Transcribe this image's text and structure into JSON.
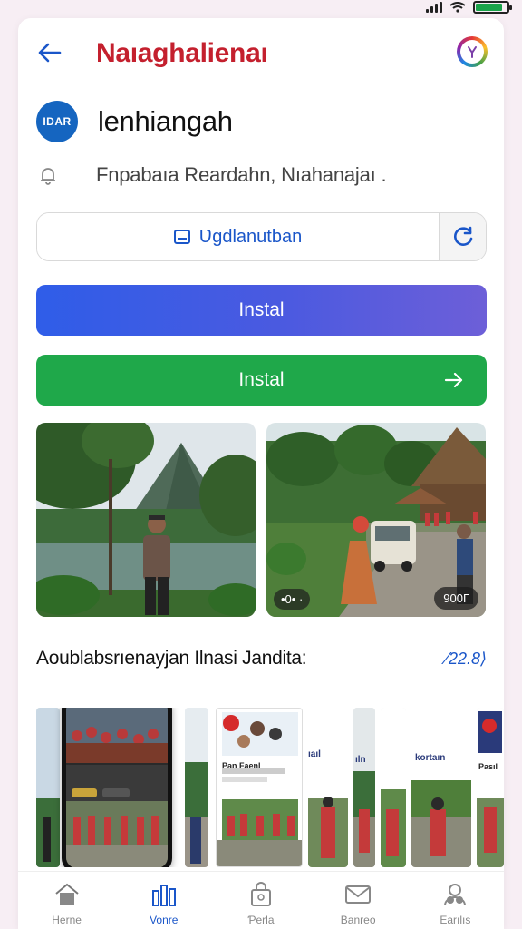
{
  "header": {
    "title": "Naıaghalienaı",
    "back_icon": "arrow-left-icon",
    "action_icon": "refresh-badge-icon"
  },
  "app": {
    "logo_text": "IDAR",
    "name": "Ɩenhiangah"
  },
  "info": {
    "icon": "bell-icon",
    "text": "Fnpabaıa Reardahn, Nıahanajaı ."
  },
  "field": {
    "label": "Ʋgdlanutban",
    "icon": "window-icon",
    "refresh_icon": "refresh-icon"
  },
  "buttons": {
    "primary_label": "Instal",
    "secondary_label": "Instal"
  },
  "photos": [
    {
      "caption": ""
    },
    {
      "badge_left": "•0• ·",
      "badge_right": "900Г"
    }
  ],
  "section": {
    "title": "Aoublabsrıenayjan Ilnasi Jandita:",
    "link": "⁄22.8⟩"
  },
  "gallery": {
    "labels": [
      "Pan Faenl",
      "ıaıl",
      "ıln",
      "kortaın",
      "Pasıl"
    ]
  },
  "tabs": [
    {
      "label": "Herne",
      "icon": "home-icon",
      "active": false
    },
    {
      "label": "Vonre",
      "icon": "bar-chart-icon",
      "active": true
    },
    {
      "label": "Ƥerla",
      "icon": "bag-icon",
      "active": false
    },
    {
      "label": "Banreo",
      "icon": "mail-icon",
      "active": false
    },
    {
      "label": "Earılıs",
      "icon": "people-icon",
      "active": false
    }
  ],
  "colors": {
    "title_red": "#c4202e",
    "primary_blue": "#2f5de8",
    "success_green": "#1fa84a",
    "link_blue": "#1a56c9",
    "battery_green": "#1aa34a"
  },
  "battery": {
    "level": 0.85
  }
}
